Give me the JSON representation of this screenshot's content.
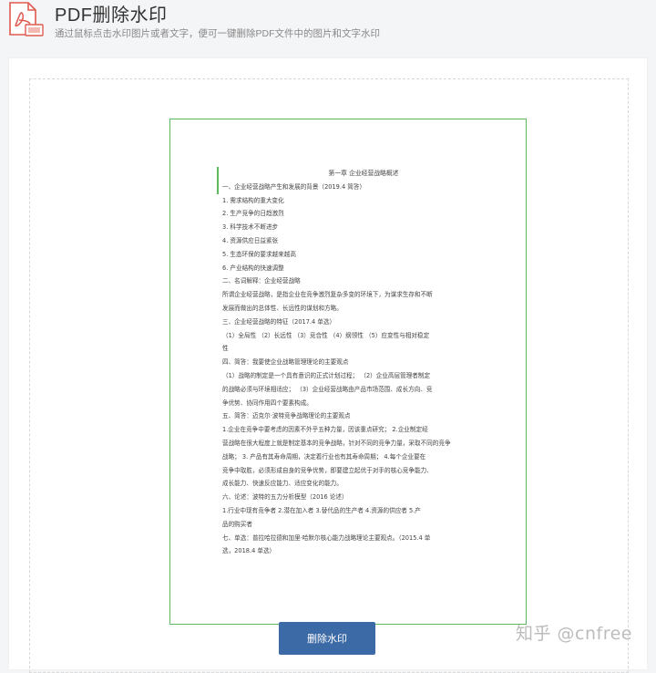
{
  "header": {
    "title": "PDF删除水印",
    "subtitle": "通过鼠标点击水印图片或者文字，便可一键删除PDF文件中的图片和文字水印",
    "icon": "pdf-file-icon"
  },
  "document": {
    "title": "第一章 企业经营战略概述",
    "lines": [
      "一、企业经营战略产生和发展的背景（2019.4 简答）",
      "1. 需求结构的重大变化",
      "2. 生产竞争的日趋激烈",
      "3. 科学技术不断进步",
      "4. 资源供应日益紧张",
      "5. 生态环保的要求越来越高",
      "6. 产业结构的快速调整",
      "二、名词解释：企业经营战略",
      "所谓企业经营战略，是指企业在竞争激烈复杂多变的环境下，为谋求生存和不断",
      "发展而做出的总体性、长远性的谋划和方略。",
      "三、企业经营战略的特征（2017.4 单选）",
      "（1）全局性 （2）长远性 （3）竞合性 （4）纲领性 （5）应变性与相对稳定",
      "性",
      "四、简答：我要使企业战略管理理论的主要观点",
      "（1）战略的制定是一个具有意识的正式计划过程；  （2）企业高层管理者制定",
      "的战略必须与环境相适应；  （3）企业经营战略由产品市场范围、成长方向、竞",
      "争优势、协同作用四个要素构成。",
      "五、简答：迈克尔·波特竞争战略理论的主要观点",
      "1.企业在竞争中要考虑的因素不外乎五种力量，因该重点研究；  2.企业制定经",
      "营战略在很大程度上就是制定基本的竞争战略，针对不同的竞争力量，采取不同的竞争",
      "战略；  3. 产品有其寿命周期，决定着行业也有其寿命周期；  4.每个企业要在",
      "竞争中取胜，必须形成自身的竞争优势，即要建立起优于对手的核心竞争能力、",
      "成长能力、快速反应能力、适应变化的能力。",
      "六、论述：波特的五力分析模型（2016 论述）",
      "1.行业中现有竞争者 2.潜在加入者 3.替代品的生产者 4.资源的供应者 5.产",
      "品的购买者",
      "七、单选：普拉哈拉德和加里·哈默尔核心能力战略理论主要观点。（2015.4 单",
      "选，2018.4 单选）"
    ]
  },
  "actions": {
    "remove_label": "删除水印"
  },
  "watermark": {
    "text": "知乎 @cnfree"
  },
  "colors": {
    "accent": "#3c6aa6",
    "page_border": "#5cb85c",
    "icon_red": "#e05a4f"
  }
}
